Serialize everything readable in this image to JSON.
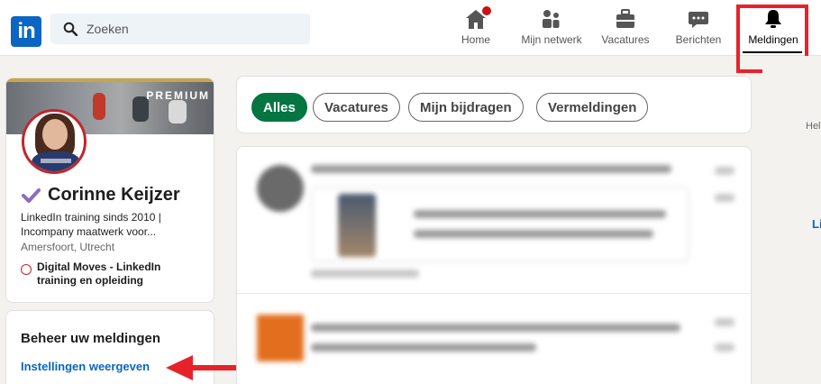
{
  "search": {
    "placeholder": "Zoeken"
  },
  "nav": {
    "home": "Home",
    "network": "Mijn netwerk",
    "jobs": "Vacatures",
    "messages": "Berichten",
    "notifications": "Meldingen"
  },
  "profile": {
    "premium": "PREMIUM",
    "name": "Corinne Keijzer",
    "headline": "LinkedIn training sinds 2010 | Incompany maatwerk voor...",
    "location": "Amersfoort, Utrecht",
    "company": "Digital Moves - LinkedIn training en opleiding"
  },
  "manage": {
    "title": "Beheer uw meldingen",
    "link": "Instellingen weergeven"
  },
  "filters": [
    "Alles",
    "Vacatures",
    "Mijn bijdragen",
    "Vermeldingen"
  ],
  "right": {
    "help": "Hel",
    "link": "Li"
  },
  "colors": {
    "brand": "#0a66c2",
    "active_pill": "#057642",
    "highlight": "#e8222a",
    "badge": "#cc1016"
  },
  "icons": {
    "logo": "linkedin-logo",
    "search": "search-icon",
    "home": "home-icon",
    "network": "people-icon",
    "jobs": "briefcase-icon",
    "messages": "chat-icon",
    "notifications": "bell-icon"
  }
}
